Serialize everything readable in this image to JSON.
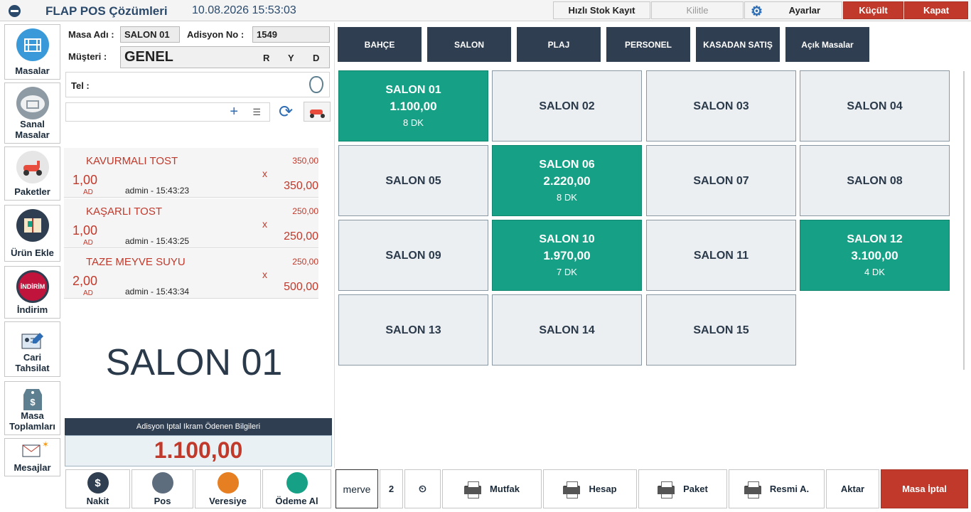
{
  "app": {
    "name": "FLAP POS Çözümleri",
    "datetime": "10.08.2026 15:53:03"
  },
  "titlebar": {
    "stock": "Hızlı Stok Kayıt",
    "lock": "Kilitle",
    "settings": "Ayarlar",
    "minimize": "Küçült",
    "close": "Kapat"
  },
  "sidebar": [
    {
      "label": "Masalar",
      "icon": "tables-icon"
    },
    {
      "label": "Sanal Masalar",
      "icon": "cloud-tables-icon"
    },
    {
      "label": "Paketler",
      "icon": "scooter-icon"
    },
    {
      "label": "Ürün Ekle",
      "icon": "book-icon"
    },
    {
      "label": "İndirim",
      "icon": "discount-icon"
    },
    {
      "label": "Cari Tahsilat",
      "icon": "account-card-icon"
    },
    {
      "label": "Masa Toplamları",
      "icon": "price-tag-icon"
    },
    {
      "label": "Mesajlar",
      "icon": "envelope-icon"
    }
  ],
  "order": {
    "table_label": "Masa Adı :",
    "table_name": "SALON 01",
    "check_label": "Adisyon No :",
    "check_no": "1549",
    "customer_label": "Müşteri :",
    "customer": "GENEL",
    "flags": [
      "R",
      "Y",
      "D"
    ],
    "phone_label": "Tel :",
    "search_value": "",
    "items": [
      {
        "name": "KAVURMALI TOST",
        "unit_price": "350,00",
        "qty": "1,00",
        "unit": "AD",
        "user": "admin - 15:43:23",
        "x": "x",
        "total": "350,00"
      },
      {
        "name": "KAŞARLI TOST",
        "unit_price": "250,00",
        "qty": "1,00",
        "unit": "AD",
        "user": "admin - 15:43:25",
        "x": "x",
        "total": "250,00"
      },
      {
        "name": "TAZE MEYVE SUYU",
        "unit_price": "250,00",
        "qty": "2,00",
        "unit": "AD",
        "user": "admin - 15:43:34",
        "x": "x",
        "total": "500,00"
      }
    ],
    "big_table": "SALON 01",
    "total_label": "Adisyon Iptal Ikram Ödenen Bilgileri",
    "total": "1.100,00"
  },
  "payments": [
    "Nakit",
    "Pos",
    "Veresiye",
    "Ödeme Al"
  ],
  "categories": [
    "BAHÇE",
    "SALON",
    "PLAJ",
    "PERSONEL",
    "KASADAN SATIŞ",
    "Açık Masalar"
  ],
  "tables": [
    {
      "name": "SALON 01",
      "amount": "1.100,00",
      "time": "8 DK",
      "busy": true
    },
    {
      "name": "SALON 02",
      "busy": false
    },
    {
      "name": "SALON 03",
      "busy": false
    },
    {
      "name": "SALON 04",
      "busy": false
    },
    {
      "name": "SALON 05",
      "busy": false
    },
    {
      "name": "SALON 06",
      "amount": "2.220,00",
      "time": "8 DK",
      "busy": true
    },
    {
      "name": "SALON 07",
      "busy": false
    },
    {
      "name": "SALON 08",
      "busy": false
    },
    {
      "name": "SALON 09",
      "busy": false
    },
    {
      "name": "SALON 10",
      "amount": "1.970,00",
      "time": "7 DK",
      "busy": true
    },
    {
      "name": "SALON 11",
      "busy": false
    },
    {
      "name": "SALON 12",
      "amount": "3.100,00",
      "time": "4 DK",
      "busy": true
    },
    {
      "name": "SALON 13",
      "busy": false
    },
    {
      "name": "SALON 14",
      "busy": false
    },
    {
      "name": "SALON 15",
      "busy": false
    }
  ],
  "bottom": {
    "user": "merve",
    "count": "2",
    "kitchen": "Mutfak",
    "bill": "Hesap",
    "package": "Paket",
    "official": "Resmi A.",
    "transfer": "Aktar",
    "cancel": "Masa İptal"
  },
  "colors": {
    "navy": "#2f3e50",
    "busy": "#16a085",
    "danger": "#c0392b"
  }
}
